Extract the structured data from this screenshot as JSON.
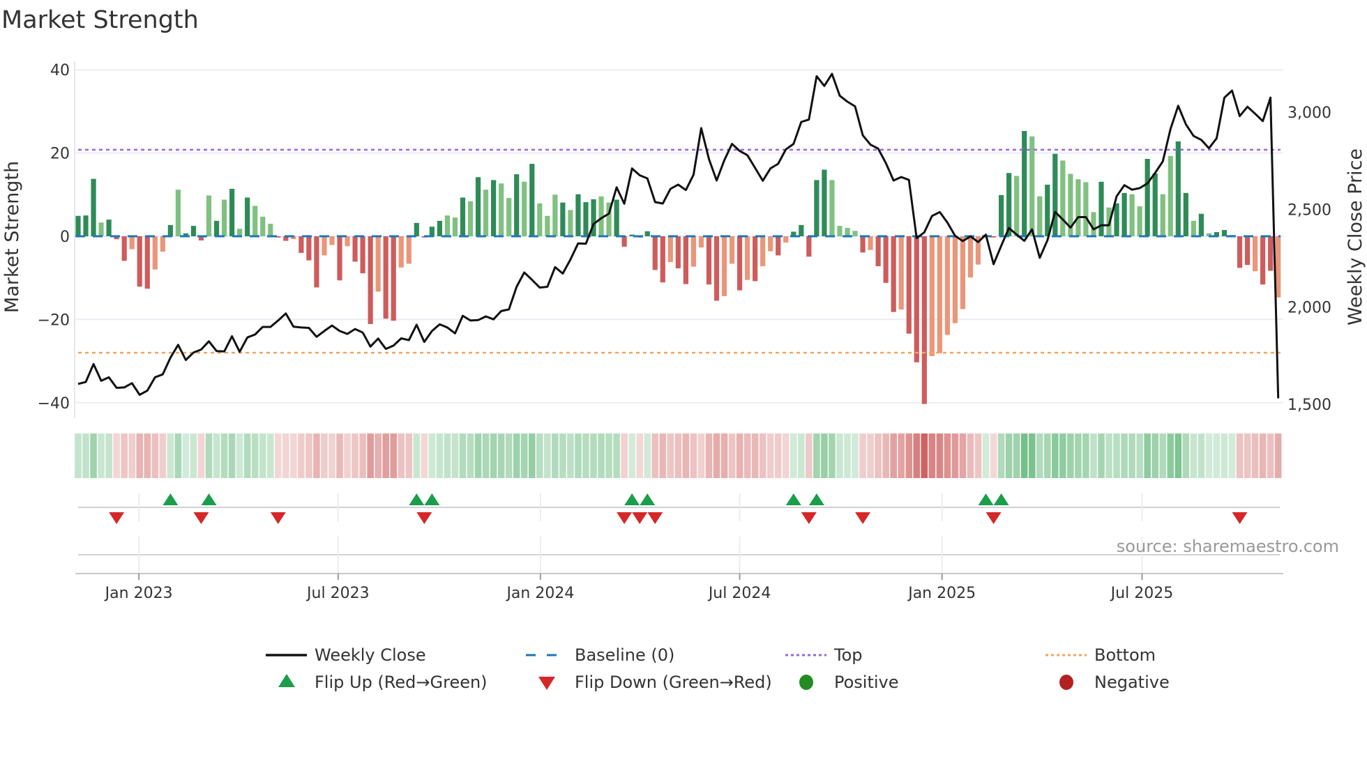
{
  "chart_data": {
    "type": "bar",
    "title": "Market Strength",
    "ylabel": "Market Strength",
    "y2label": "Weekly Close Price",
    "ylim": [
      -40,
      40
    ],
    "y2lim": [
      1500,
      3000
    ],
    "yticks": [
      40,
      20,
      0,
      -20,
      -40
    ],
    "yticklabels": [
      "40",
      "20",
      "0",
      "−20",
      "−40"
    ],
    "y2ticks": [
      3000,
      2500,
      2000,
      1500
    ],
    "y2ticklabels": [
      "3,000",
      "2,500",
      "2,000",
      "1,500"
    ],
    "x_unit": "week index",
    "xticks": [
      {
        "label": "Jan 2023",
        "week": 8.9
      },
      {
        "label": "Jul 2023",
        "week": 34.8
      },
      {
        "label": "Jan 2024",
        "week": 61.1
      },
      {
        "label": "Jul 2024",
        "week": 87.0
      },
      {
        "label": "Jan 2025",
        "week": 113.3
      },
      {
        "label": "Jul 2025",
        "week": 139.3
      }
    ],
    "reference_lines": {
      "top": 20.8,
      "bottom": -28.0,
      "baseline": 0
    },
    "strength": [
      4.9,
      5.0,
      13.8,
      3.3,
      4.0,
      -0.7,
      -5.9,
      -3.1,
      -12.1,
      -12.6,
      -8.0,
      -3.7,
      2.7,
      11.2,
      0.7,
      2.5,
      -1.0,
      9.8,
      3.7,
      8.8,
      11.4,
      1.8,
      9.3,
      7.3,
      4.7,
      3.0,
      -0.3,
      -1.1,
      -0.7,
      -4.0,
      -5.8,
      -12.3,
      -4.6,
      -2.1,
      -10.6,
      -2.4,
      -6.1,
      -8.9,
      -21.1,
      -13.3,
      -19.8,
      -20.3,
      -7.5,
      -6.6,
      3.2,
      -0.3,
      2.3,
      3.7,
      5.0,
      4.5,
      9.3,
      8.4,
      14.2,
      11.2,
      13.5,
      12.7,
      9.2,
      14.9,
      13.1,
      17.4,
      7.9,
      4.9,
      10.0,
      8.1,
      6.3,
      10.1,
      8.2,
      8.9,
      9.6,
      8.1,
      8.8,
      -2.5,
      0.4,
      -0.3,
      1.2,
      -8.1,
      -11.1,
      -6.2,
      -7.7,
      -11.5,
      -7.3,
      -2.7,
      -11.6,
      -15.5,
      -14.4,
      -6.6,
      -13.0,
      -10.5,
      -10.8,
      -7.2,
      -3.6,
      -4.6,
      -1.5,
      1.1,
      2.7,
      -4.9,
      13.5,
      16.0,
      13.5,
      2.5,
      2.0,
      1.3,
      -3.9,
      -3.3,
      -7.2,
      -11.2,
      -18.2,
      -17.6,
      -23.4,
      -30.3,
      -40.3,
      -28.8,
      -28.1,
      -23.7,
      -20.9,
      -17.5,
      -9.9,
      -6.8,
      0.3,
      -0.3,
      9.9,
      15.2,
      14.5,
      25.3,
      24.0,
      9.6,
      12.4,
      19.8,
      18.2,
      15.0,
      13.7,
      13.0,
      5.8,
      13.1,
      6.9,
      7.9,
      10.4,
      10.1,
      7.2,
      18.6,
      15.1,
      10.1,
      19.3,
      22.8,
      10.4,
      3.7,
      5.4,
      0.7,
      1.0,
      1.5,
      0.3,
      -7.6,
      -6.9,
      -8.4,
      -11.6,
      -8.3,
      -14.7
    ],
    "shade": "dddldddldd lldldddldl dldlllddld ddlldldddl ddllddddl ldldldlldl dllldldddl l dddddddldd llddlldldl ldldddddll lldldddldd dllllllldd ddldlldd ll llldldd lld d lldd ldlddl ddldd l d",
    "shade_note": "d = darker shade, l = lighter shade",
    "weekly_close": [
      1604,
      1614,
      1706,
      1620,
      1638,
      1584,
      1586,
      1608,
      1548,
      1570,
      1638,
      1653,
      1739,
      1805,
      1727,
      1765,
      1781,
      1823,
      1773,
      1771,
      1849,
      1769,
      1843,
      1858,
      1897,
      1897,
      1930,
      1966,
      1898,
      1894,
      1892,
      1846,
      1876,
      1904,
      1876,
      1861,
      1886,
      1868,
      1796,
      1837,
      1784,
      1801,
      1838,
      1829,
      1908,
      1820,
      1876,
      1910,
      1894,
      1864,
      1954,
      1930,
      1932,
      1951,
      1936,
      1978,
      1987,
      2103,
      2177,
      2139,
      2099,
      2103,
      2204,
      2171,
      2243,
      2326,
      2324,
      2425,
      2455,
      2479,
      2614,
      2530,
      2711,
      2676,
      2660,
      2538,
      2531,
      2606,
      2628,
      2600,
      2679,
      2918,
      2759,
      2649,
      2753,
      2837,
      2801,
      2779,
      2714,
      2648,
      2711,
      2735,
      2809,
      2837,
      2950,
      2962,
      3185,
      3135,
      3197,
      3085,
      3054,
      3030,
      2881,
      2833,
      2813,
      2739,
      2649,
      2667,
      2652,
      2353,
      2383,
      2467,
      2487,
      2433,
      2365,
      2338,
      2362,
      2333,
      2371,
      2219,
      2314,
      2405,
      2371,
      2339,
      2398,
      2252,
      2342,
      2488,
      2449,
      2407,
      2461,
      2461,
      2398,
      2419,
      2419,
      2568,
      2625,
      2602,
      2610,
      2634,
      2688,
      2747,
      2914,
      3033,
      2938,
      2878,
      2858,
      2815,
      2866,
      3075,
      3111,
      2980,
      3028,
      2992,
      2954,
      3075,
      1530
    ],
    "flip_up_weeks": [
      13,
      18,
      45,
      47,
      73,
      75,
      94,
      97,
      119,
      121
    ],
    "flip_down_weeks": [
      6,
      17,
      27,
      46,
      72,
      74,
      76,
      96,
      103,
      120,
      152
    ],
    "legend_placement": "bottom",
    "legend": [
      {
        "key": "close",
        "label": "Weekly Close"
      },
      {
        "key": "baseline",
        "label": "Baseline (0)"
      },
      {
        "key": "top",
        "label": "Top"
      },
      {
        "key": "bottom",
        "label": "Bottom"
      },
      {
        "key": "flip_up",
        "label": "Flip Up (Red→Green)"
      },
      {
        "key": "flip_down",
        "label": "Flip Down (Green→Red)"
      },
      {
        "key": "positive",
        "label": "Positive"
      },
      {
        "key": "negative",
        "label": "Negative"
      }
    ],
    "source": "source: sharemaestro.com"
  },
  "colors": {
    "pos_dark": "#2e8b57",
    "pos_light": "#80c080",
    "neg_dark": "#cd5c5c",
    "neg_light": "#e9967a",
    "close": "#111111",
    "baseline": "#1f77b4",
    "top": "#9966dd",
    "bottom": "#f4a460",
    "flip_up": "#1a9e4a",
    "flip_down": "#d62728",
    "positive": "#228b22",
    "negative": "#b22222"
  }
}
